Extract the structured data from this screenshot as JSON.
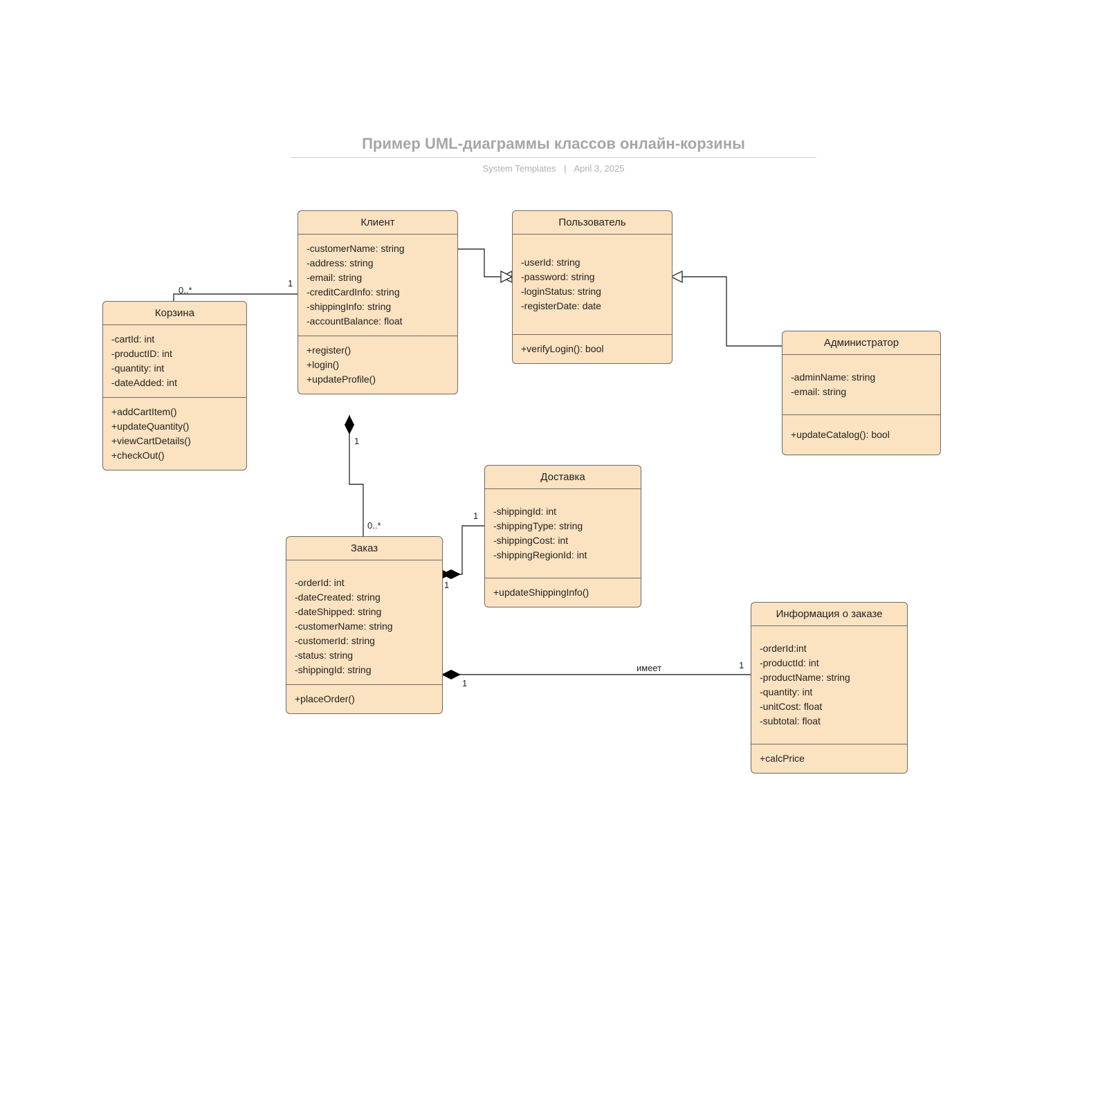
{
  "header": {
    "title": "Пример UML-диаграммы классов онлайн-корзины",
    "author": "System Templates",
    "date": "April 3, 2025"
  },
  "classes": {
    "cart": {
      "name": "Корзина",
      "attrs": "-cartId: int\n-productID: int\n-quantity: int\n-dateAdded: int",
      "ops": "+addCartItem()\n+updateQuantity()\n+viewCartDetails()\n+checkOut()"
    },
    "client": {
      "name": "Клиент",
      "attrs": "-customerName: string\n-address: string\n-email: string\n-creditCardInfo: string\n-shippingInfo: string\n-accountBalance: float",
      "ops": "+register()\n+login()\n+updateProfile()"
    },
    "user": {
      "name": "Пользователь",
      "attrs": "-userId: string\n-password: string\n-loginStatus: string\n-registerDate: date",
      "ops": "+verifyLogin(): bool"
    },
    "admin": {
      "name": "Администратор",
      "attrs": "-adminName: string\n-email: string",
      "ops": "+updateCatalog(): bool"
    },
    "order": {
      "name": "Заказ",
      "attrs": "-orderId: int\n-dateCreated: string\n-dateShipped: string\n-customerName: string\n-customerId: string\n-status: string\n-shippingId: string",
      "ops": "+placeOrder()"
    },
    "shipping": {
      "name": "Доставка",
      "attrs": "-shippingId: int\n-shippingType: string\n-shippingCost: int\n-shippingRegionId: int",
      "ops": "+updateShippingInfo()"
    },
    "orderInfo": {
      "name": "Информация о заказе",
      "attrs": "-orderId:int\n-productId: int\n-productName: string\n-quantity: int\n-unitCost: float\n-subtotal: float",
      "ops": "+calcPrice"
    }
  },
  "multiplicities": {
    "cart_to_client_cartEnd": "0..*",
    "cart_to_client_clientEnd": "1",
    "client_to_order_clientEnd": "1",
    "client_to_order_orderEnd": "0..*",
    "order_to_shipping_orderEnd": "1",
    "order_to_shipping_shippingEnd": "1",
    "order_to_orderInfo_orderEnd": "1",
    "order_to_orderInfo_infoEnd": "1"
  },
  "edgeLabels": {
    "order_has_orderInfo": "имеет"
  }
}
